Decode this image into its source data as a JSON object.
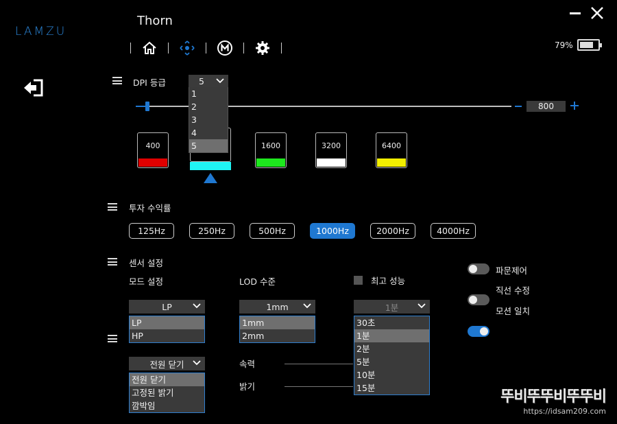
{
  "app": {
    "logo": "LAMZU",
    "device_name": "Thorn"
  },
  "battery": {
    "percent_label": "79%",
    "level": 0.79
  },
  "icons": {
    "home": "home-icon",
    "move": "move-arrows-icon",
    "macro": "macro-m-icon",
    "settings": "gear-icon",
    "exit": "exit-icon"
  },
  "dpi": {
    "section_label": "DPI 등급",
    "level_select": {
      "value": "5",
      "options": [
        "1",
        "2",
        "3",
        "4",
        "5"
      ],
      "selected_index": 4
    },
    "value": "800",
    "minus": "−",
    "plus": "+",
    "slider_fraction": 0.0,
    "levels": [
      {
        "value": "400",
        "color": "#e00000"
      },
      {
        "value": "800",
        "color": "#1ff4f4"
      },
      {
        "value": "1600",
        "color": "#1ee81e"
      },
      {
        "value": "3200",
        "color": "#ffffff"
      },
      {
        "value": "6400",
        "color": "#f2ee00"
      }
    ],
    "selected_level_index": 1
  },
  "polling": {
    "section_label": "투자 수익률",
    "rates": [
      "125Hz",
      "250Hz",
      "500Hz",
      "1000Hz",
      "2000Hz",
      "4000Hz"
    ],
    "active_index": 3
  },
  "sensor": {
    "section_label": "센서 설정",
    "mode": {
      "label": "모드 설정",
      "value": "LP",
      "options": [
        "LP",
        "HP"
      ],
      "selected_index": 0
    },
    "lod": {
      "label": "LOD 수준",
      "value": "1mm",
      "options": [
        "1mm",
        "2mm"
      ],
      "selected_index": 0
    },
    "top_perf": {
      "label": "최고 성능",
      "checked": false
    },
    "sleep": {
      "value": "1분",
      "options": [
        "30초",
        "1분",
        "2분",
        "5분",
        "10분",
        "15분"
      ],
      "selected_index": 1
    },
    "toggles": [
      {
        "label": "파문제어",
        "on": false
      },
      {
        "label": "직선 수정",
        "on": false
      },
      {
        "label": "모션 일치",
        "on": true
      }
    ]
  },
  "light": {
    "effect": {
      "value": "전원 닫기",
      "options": [
        "전원 닫기",
        "고정된 밝기",
        "깜박임"
      ],
      "selected_index": 0
    },
    "speed_label": "속력",
    "brightness_label": "밝기"
  },
  "watermark": {
    "title": "뚜비뚜뚜비뚜뚜비",
    "url": "https://idsam209.com"
  },
  "colors": {
    "accent": "#1f78d1",
    "logo": "#2b86d9"
  }
}
